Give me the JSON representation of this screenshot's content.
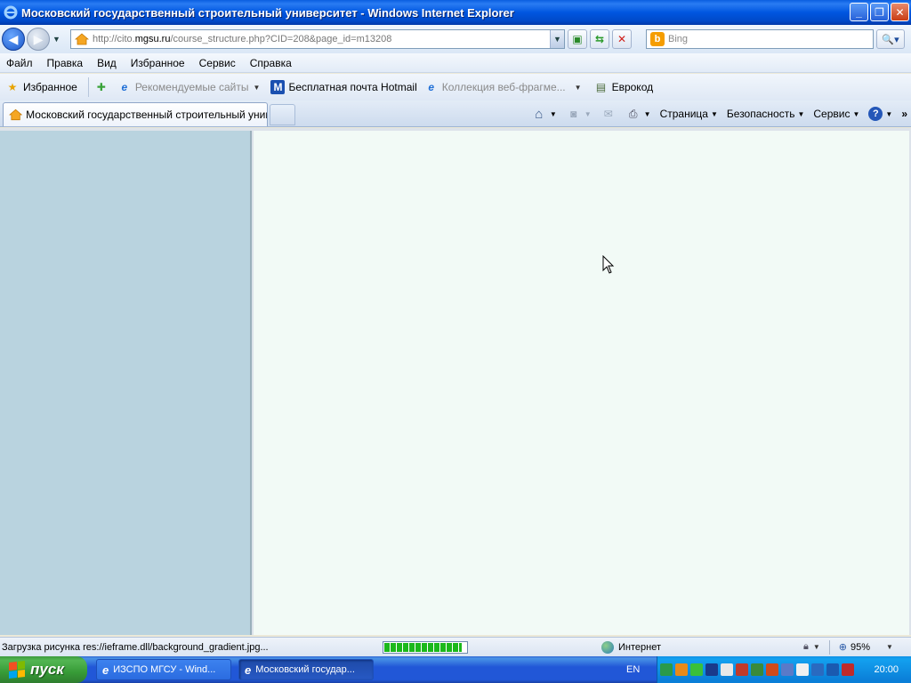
{
  "window": {
    "title": "Московский государственный строительный университет - Windows Internet Explorer"
  },
  "address": {
    "url_prefix": "http://cito.",
    "url_domain": "mgsu.ru",
    "url_path": "/course_structure.php?CID=208&page_id=m13208",
    "search_placeholder": "Bing"
  },
  "menu": {
    "items": [
      "Файл",
      "Правка",
      "Вид",
      "Избранное",
      "Сервис",
      "Справка"
    ]
  },
  "favorites": {
    "favorites_label": "Избранное",
    "suggested_sites": "Рекомендуемые сайты",
    "hotmail": "Бесплатная почта Hotmail",
    "web_slice_gallery": "Коллекция веб-фрагме...",
    "euro_code": "Еврокод"
  },
  "tabs": {
    "active_tab": "Московский государственный строительный унив..."
  },
  "commands": {
    "page": "Страница",
    "safety": "Безопасность",
    "tools": "Сервис"
  },
  "status": {
    "text": "Загрузка рисунка res://ieframe.dll/background_gradient.jpg...",
    "progress": 0.95,
    "zone": "Интернет",
    "zoom": "95%"
  },
  "taskbar": {
    "start_label": "пуск",
    "tasks": [
      "ИЗСПО МГСУ - Wind...",
      "Московский государ..."
    ],
    "language": "EN",
    "clock": "20:00"
  },
  "colors": {
    "left_pane": "#b9d3df",
    "main_pane": "#f2faf6",
    "title_bar": "#0056e0"
  }
}
